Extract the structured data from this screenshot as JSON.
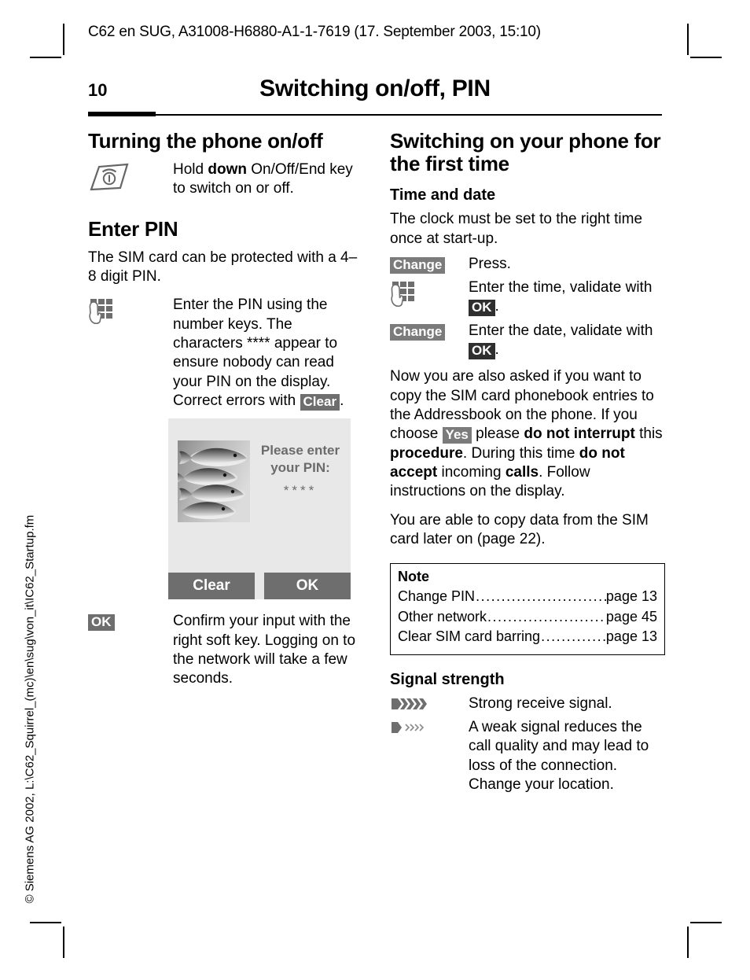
{
  "document": {
    "running_header": "C62 en SUG, A31008-H6880-A1-1-7619 (17. September 2003, 15:10)",
    "page_number": "10",
    "chapter_title": "Switching on/off, PIN",
    "vertical_copyright": "© Siemens AG 2002, L:\\C62_Squirrel_(mc)\\en\\sug\\von_it\\IC62_Startup.fm"
  },
  "left_column": {
    "section_turning": {
      "heading": "Turning the phone on/off",
      "row": {
        "icon": "onoff-key-icon",
        "text_a": "Hold ",
        "text_bold": "down",
        "text_b": " On/Off/End key to switch on or off."
      }
    },
    "section_pin": {
      "heading": "Enter PIN",
      "intro": "The SIM card can be protected with a 4–8 digit PIN.",
      "row": {
        "icon": "keypad-icon",
        "text_a": "Enter the PIN using the number keys. The characters **** appear to ensure nobody can read your PIN on the display. Correct errors with ",
        "badge": "Clear",
        "text_b": "."
      },
      "display": {
        "wallpaper": "fish-wallpaper",
        "prompt_line1": "Please enter",
        "prompt_line2": "your PIN:",
        "masked_value": "****",
        "softkey_left": "Clear",
        "softkey_right": "OK"
      },
      "confirm_row": {
        "badge": "OK",
        "text": "Confirm your input with the right soft key. Logging on to the network will take a few seconds."
      }
    }
  },
  "right_column": {
    "heading": "Switching on your phone for the first time",
    "time_and_date": {
      "subheading": "Time and date",
      "intro": "The clock must be set to the right time once at start-up.",
      "steps": [
        {
          "badge": "Change",
          "badge_style": "mid",
          "icon": null,
          "text_a": "Press.",
          "badge_inline": null,
          "text_b": ""
        },
        {
          "badge": null,
          "badge_style": null,
          "icon": "keypad-icon",
          "text_a": "Enter the time, validate with ",
          "badge_inline": "OK",
          "text_b": "."
        },
        {
          "badge": "Change",
          "badge_style": "mid",
          "icon": null,
          "text_a": "Enter the date, validate with ",
          "badge_inline": "OK",
          "text_b": "."
        }
      ]
    },
    "copy_paragraph": {
      "p1_a": "Now you are also asked if you want to copy the SIM card phonebook entries to the Addressbook on the phone. If you choose ",
      "p1_badge": "Yes",
      "p1_b": " please ",
      "p1_bold1": "do not interrupt",
      "p1_c": " this ",
      "p1_bold2": "procedure",
      "p1_d": ". During this time ",
      "p1_bold3": "do not accept",
      "p1_e": " incoming ",
      "p1_bold4": "calls",
      "p1_f": ". Follow instructions on the display.",
      "p2": "You are able to copy data from the SIM card later on (page 22)."
    },
    "note_box": {
      "title": "Note",
      "entries": [
        {
          "label": "Change PIN",
          "page": "page 13"
        },
        {
          "label": "Other network",
          "page": "page 45"
        },
        {
          "label": "Clear SIM card barring ",
          "page": "page 13"
        }
      ]
    },
    "signal_strength": {
      "subheading": "Signal strength",
      "rows": [
        {
          "icon": "signal-strong-icon",
          "text": "Strong receive signal."
        },
        {
          "icon": "signal-weak-icon",
          "text": "A weak signal reduces the call quality and may lead to loss of the connection. Change your location."
        }
      ]
    }
  },
  "colors": {
    "badge_gray": "#6e6e6e",
    "badge_dark": "#2f2f2f",
    "display_bg": "#e8e8e8",
    "display_text": "#6b6b6b"
  }
}
